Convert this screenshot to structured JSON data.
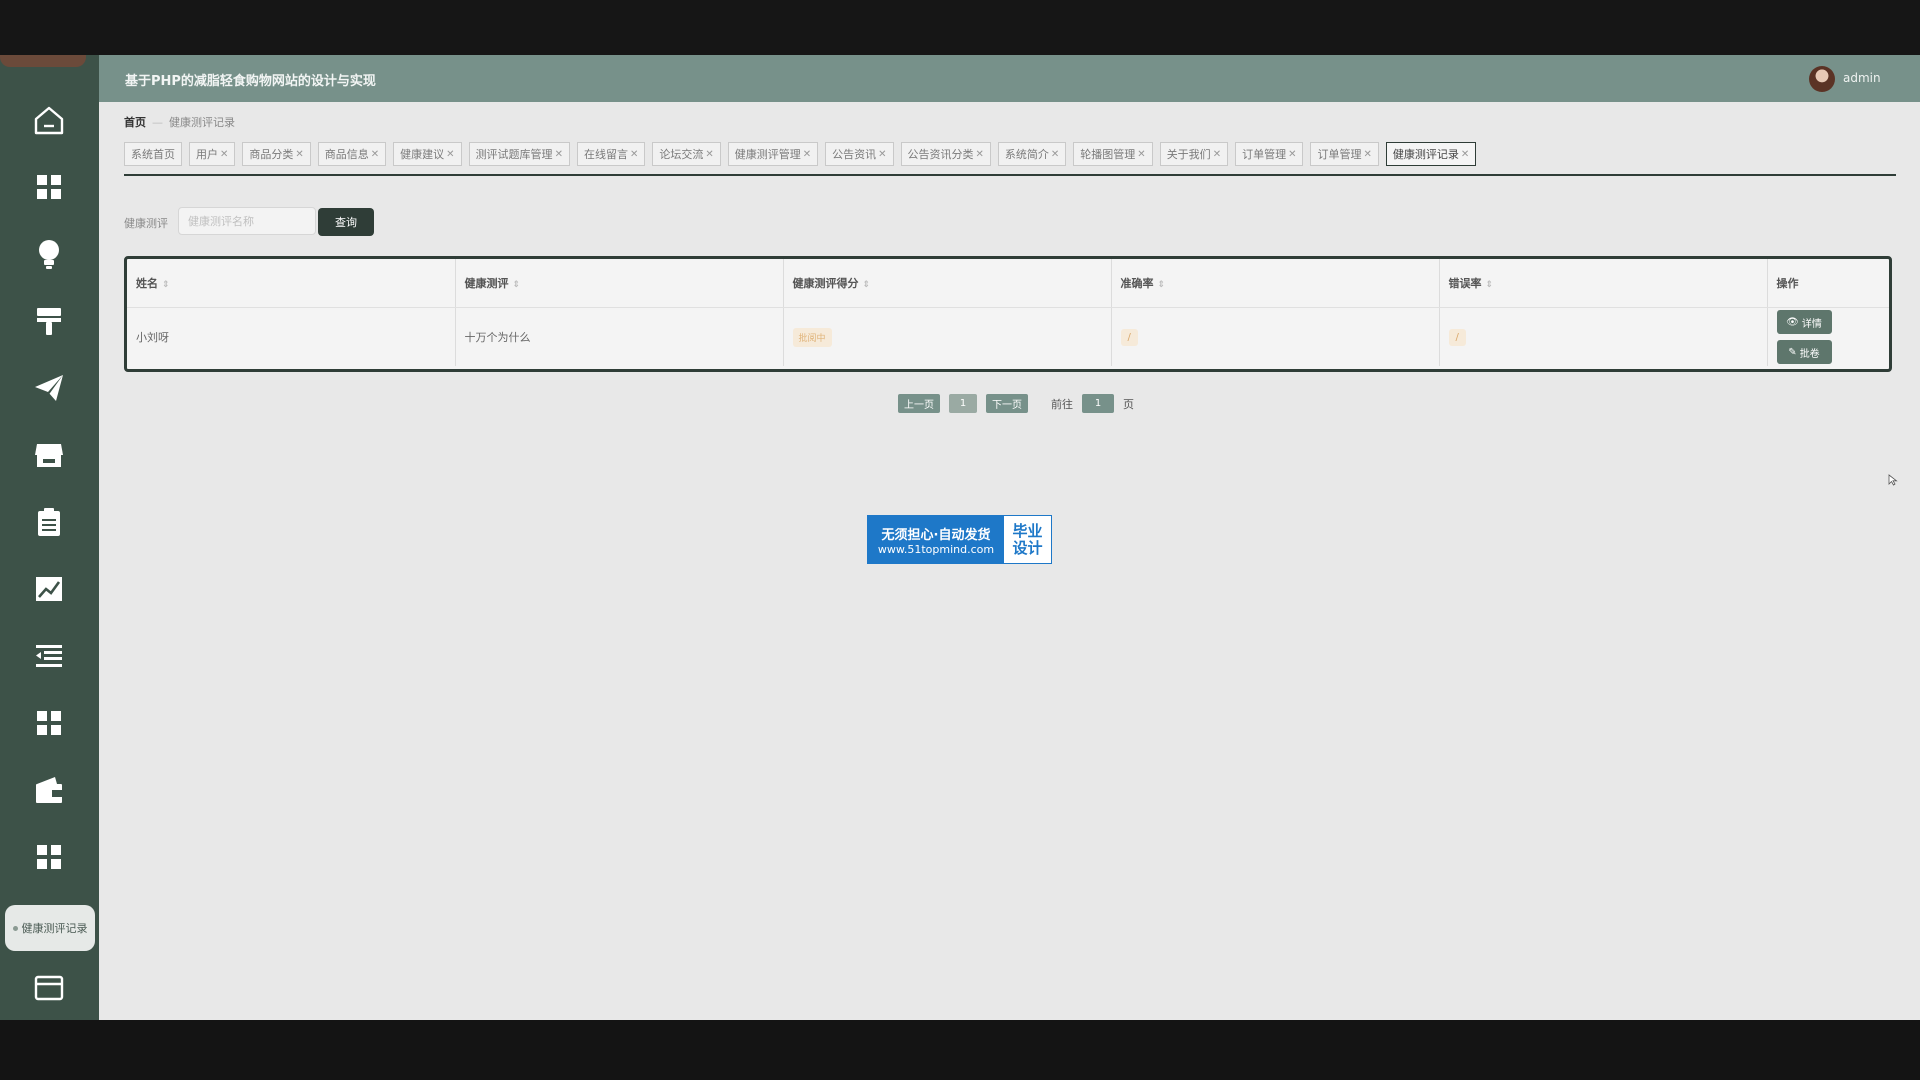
{
  "header": {
    "title": "基于PHP的减脂轻食购物网站的设计与实现",
    "username": "admin"
  },
  "sidebar": {
    "icons": [
      "home-icon",
      "grid-icon",
      "bulb-icon",
      "brush-icon",
      "paper-plane-icon",
      "store-icon",
      "clipboard-icon",
      "chart-line-icon",
      "menu-collapse-icon",
      "grid-icon",
      "wallet-icon",
      "grid-icon",
      "card-icon"
    ],
    "active_label": "健康测评记录"
  },
  "breadcrumb": {
    "home": "首页",
    "current": "健康测评记录"
  },
  "tabs": [
    {
      "label": "系统首页",
      "closable": false
    },
    {
      "label": "用户",
      "closable": true
    },
    {
      "label": "商品分类",
      "closable": true
    },
    {
      "label": "商品信息",
      "closable": true
    },
    {
      "label": "健康建议",
      "closable": true
    },
    {
      "label": "测评试题库管理",
      "closable": true
    },
    {
      "label": "在线留言",
      "closable": true
    },
    {
      "label": "论坛交流",
      "closable": true
    },
    {
      "label": "健康测评管理",
      "closable": true
    },
    {
      "label": "公告资讯",
      "closable": true
    },
    {
      "label": "公告资讯分类",
      "closable": true
    },
    {
      "label": "系统简介",
      "closable": true
    },
    {
      "label": "轮播图管理",
      "closable": true
    },
    {
      "label": "关于我们",
      "closable": true
    },
    {
      "label": "订单管理",
      "closable": true
    },
    {
      "label": "订单管理",
      "closable": true
    },
    {
      "label": "健康测评记录",
      "closable": true,
      "active": true
    }
  ],
  "search": {
    "label": "健康测评",
    "placeholder": "健康测评名称",
    "value": "",
    "button": "查询"
  },
  "table": {
    "columns": [
      "姓名",
      "健康测评",
      "健康测评得分",
      "准确率",
      "错误率",
      "操作"
    ],
    "rows": [
      {
        "name": "小刘呀",
        "exam": "十万个为什么",
        "score": "批阅中",
        "accuracy": "/",
        "error_rate": "/",
        "actions": [
          "详情",
          "批卷"
        ]
      }
    ]
  },
  "pagination": {
    "prev": "上一页",
    "current_page": "1",
    "next": "下一页",
    "goto_prefix": "前往",
    "goto_value": "1",
    "goto_suffix": "页"
  },
  "watermark": {
    "line1": "无须担心·自动发货",
    "line2": "www.51topmind.com",
    "right1": "毕业",
    "right2": "设计"
  },
  "colors": {
    "sidebar": "#3d5248",
    "header": "#77918a",
    "primary_dark": "#2f3d37",
    "warning_bg": "#f6ead9",
    "watermark_blue": "#1e78c8"
  }
}
